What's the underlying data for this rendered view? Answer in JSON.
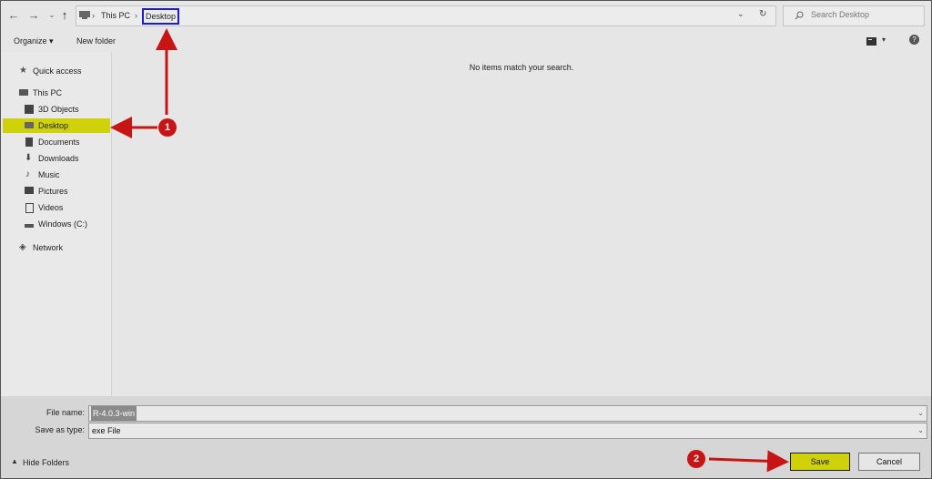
{
  "address": {
    "crumbs": [
      "This PC",
      "Desktop"
    ]
  },
  "search": {
    "placeholder": "Search Desktop"
  },
  "toolbar": {
    "organize": "Organize",
    "new_folder": "New folder"
  },
  "nav": [
    "Quick access",
    "This PC",
    "3D Objects",
    "Desktop",
    "Documents",
    "Downloads",
    "Music",
    "Pictures",
    "Videos",
    "Windows (C:)",
    "Network"
  ],
  "content": {
    "empty_message": "No items match your search."
  },
  "fields": {
    "file_name_label": "File name:",
    "file_name_value": "R-4.0.3-win",
    "save_type_label": "Save as type:",
    "save_type_value": "exe File"
  },
  "footer": {
    "hide_folders": "Hide Folders",
    "save": "Save",
    "cancel": "Cancel"
  },
  "annotations": {
    "badge1": "1",
    "badge2": "2"
  },
  "colors": {
    "highlight": "#cfd10b",
    "annotation": "#c81414",
    "selection_box": "#1a1ad8"
  }
}
